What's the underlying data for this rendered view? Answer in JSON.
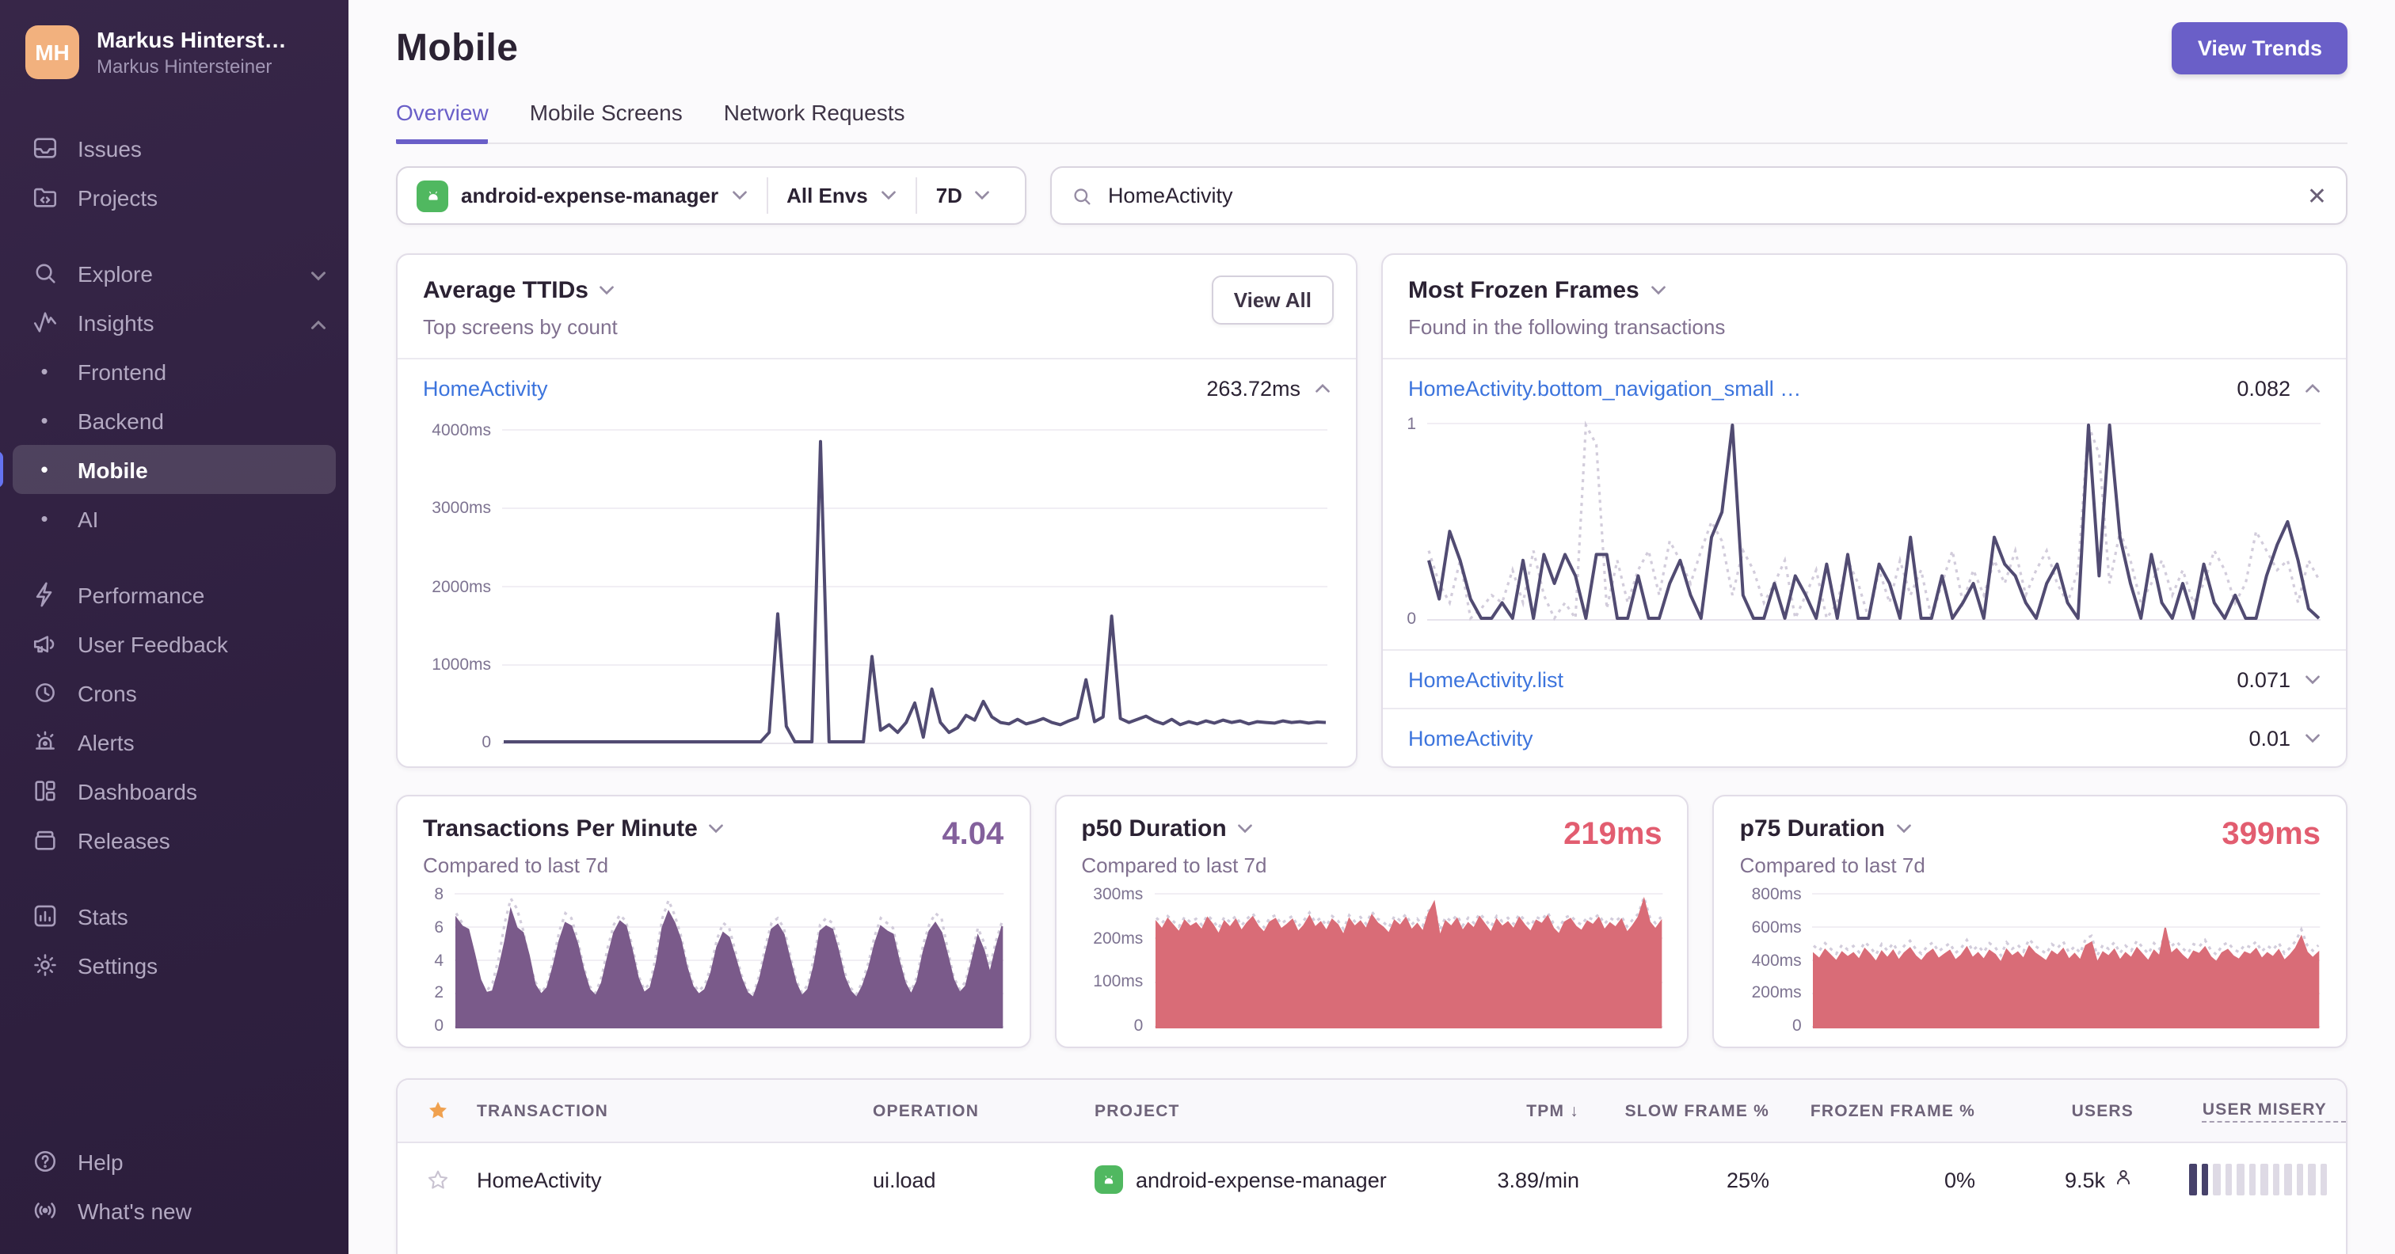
{
  "colors": {
    "accent": "#6a5fc8",
    "link": "#3c74dd",
    "star": "#f0a14f",
    "android": "#50b860",
    "purple_text": "#83609c",
    "salmon_text": "#e25d70",
    "misery_dark": "#47426b",
    "misery_light": "#dedae5",
    "sidebar_bg": "#2f2040",
    "dark_line": "#514b72",
    "compare_dotted": "#d2ccdb",
    "purple_fill": "#7a5a8a",
    "salmon_fill": "#d96c77"
  },
  "sidebar": {
    "user": {
      "initials": "MH",
      "name": "Markus Hinterst…",
      "org": "Markus Hintersteiner"
    },
    "items": [
      {
        "label": "Issues"
      },
      {
        "label": "Projects"
      },
      {
        "label": "Explore",
        "chevron": "down"
      },
      {
        "label": "Insights",
        "chevron": "up"
      },
      {
        "label": "Frontend"
      },
      {
        "label": "Backend"
      },
      {
        "label": "Mobile",
        "active": true
      },
      {
        "label": "AI"
      },
      {
        "label": "Performance"
      },
      {
        "label": "User Feedback"
      },
      {
        "label": "Crons"
      },
      {
        "label": "Alerts"
      },
      {
        "label": "Dashboards"
      },
      {
        "label": "Releases"
      },
      {
        "label": "Stats"
      },
      {
        "label": "Settings"
      },
      {
        "label": "Help"
      },
      {
        "label": "What's new"
      }
    ]
  },
  "header": {
    "title": "Mobile",
    "view_trends": "View Trends"
  },
  "tabs": [
    {
      "label": "Overview",
      "active": true
    },
    {
      "label": "Mobile Screens",
      "active": false
    },
    {
      "label": "Network Requests",
      "active": false
    }
  ],
  "filters": {
    "project": "android-expense-manager",
    "env": "All Envs",
    "period": "7D"
  },
  "search": {
    "value": "HomeActivity"
  },
  "cards": {
    "ttid": {
      "title": "Average TTIDs",
      "subtitle": "Top screens by count",
      "action": "View All",
      "row": {
        "name": "HomeActivity",
        "value": "263.72ms"
      }
    },
    "frozen": {
      "title": "Most Frozen Frames",
      "subtitle": "Found in the following transactions",
      "rows": [
        {
          "name": "HomeActivity.bottom_navigation_small …",
          "value": "0.082"
        },
        {
          "name": "HomeActivity.list",
          "value": "0.071"
        },
        {
          "name": "HomeActivity",
          "value": "0.01"
        }
      ]
    },
    "tpm": {
      "title": "Transactions Per Minute",
      "subtitle": "Compared to last 7d",
      "value": "4.04"
    },
    "p50": {
      "title": "p50 Duration",
      "subtitle": "Compared to last 7d",
      "value": "219ms"
    },
    "p75": {
      "title": "p75 Duration",
      "subtitle": "Compared to last 7d",
      "value": "399ms"
    }
  },
  "table": {
    "columns": {
      "transaction": "TRANSACTION",
      "operation": "OPERATION",
      "project": "PROJECT",
      "tpm": "TPM",
      "sort_arrow": "↓",
      "slow": "SLOW FRAME %",
      "frozen": "FROZEN FRAME %",
      "users": "USERS",
      "misery": "USER MISERY"
    },
    "rows": [
      {
        "transaction": "HomeActivity",
        "operation": "ui.load",
        "project": "android-expense-manager",
        "tpm": "3.89/min",
        "slow": "25%",
        "frozen": "0%",
        "users": "9.5k",
        "misery_filled": 2,
        "misery_total": 12
      }
    ]
  },
  "chart_data": {
    "ttid": {
      "type": "line",
      "title": "Average TTIDs - HomeActivity",
      "ylabel": "ms",
      "color": "#514b72",
      "ylim": [
        0,
        4000
      ],
      "yticks": [
        "4000ms",
        "3000ms",
        "2000ms",
        "1000ms",
        "0"
      ],
      "values": [
        0,
        0,
        0,
        0,
        0,
        0,
        0,
        0,
        0,
        0,
        0,
        0,
        0,
        0,
        0,
        0,
        0,
        0,
        0,
        0,
        0,
        0,
        0,
        0,
        0,
        0,
        0,
        0,
        0,
        0,
        0,
        120,
        1650,
        200,
        0,
        0,
        0,
        3870,
        0,
        0,
        0,
        0,
        0,
        1100,
        150,
        220,
        120,
        250,
        500,
        60,
        680,
        250,
        120,
        180,
        340,
        280,
        520,
        320,
        250,
        230,
        290,
        230,
        260,
        300,
        250,
        220,
        270,
        310,
        800,
        260,
        320,
        1620,
        300,
        250,
        290,
        330,
        270,
        230,
        290,
        220,
        260,
        230,
        270,
        240,
        280,
        250,
        270,
        230,
        260,
        250,
        240,
        270,
        250,
        260,
        240,
        255,
        250
      ]
    },
    "frozen": {
      "type": "line",
      "title": "Most Frozen Frames - HomeActivity.bottom_navigation_small",
      "color": "#514b72",
      "compare_color": "#d2ccdb",
      "ylim": [
        0,
        1
      ],
      "yticks": [
        "1",
        "0"
      ],
      "values": [
        0.3,
        0.1,
        0.45,
        0.3,
        0.1,
        0,
        0,
        0.08,
        0,
        0.3,
        0,
        0.33,
        0.18,
        0.33,
        0.22,
        0,
        0.33,
        0.33,
        0,
        0,
        0.22,
        0,
        0,
        0.18,
        0.3,
        0.12,
        0,
        0.42,
        0.55,
        1,
        0.12,
        0,
        0,
        0.18,
        0,
        0.22,
        0.12,
        0,
        0.28,
        0,
        0.33,
        0,
        0,
        0.28,
        0.18,
        0,
        0.42,
        0,
        0,
        0.22,
        0,
        0.08,
        0.18,
        0,
        0.42,
        0.28,
        0.22,
        0.08,
        0,
        0.18,
        0.28,
        0.08,
        0,
        1,
        0.22,
        1,
        0.42,
        0.18,
        0,
        0.33,
        0.08,
        0,
        0.18,
        0,
        0.28,
        0.08,
        0,
        0.12,
        0,
        0,
        0.22,
        0.38,
        0.5,
        0.3,
        0.05,
        0
      ],
      "compare": [
        0.35,
        0.18,
        0.08,
        0.3,
        0,
        0.05,
        0.12,
        0.08,
        0.25,
        0.08,
        0.35,
        0.12,
        0,
        0.08,
        0,
        1,
        0.9,
        0.05,
        0.3,
        0.08,
        0.25,
        0.35,
        0.12,
        0.4,
        0.3,
        0.18,
        0.35,
        0.5,
        0.4,
        0.12,
        0.35,
        0.25,
        0.08,
        0.18,
        0.3,
        0,
        0.12,
        0.25,
        0,
        0.08,
        0.3,
        0.18,
        0,
        0.25,
        0.08,
        0.3,
        0.12,
        0.25,
        0,
        0.18,
        0.35,
        0.08,
        0.25,
        0.12,
        0.3,
        0.18,
        0.35,
        0.12,
        0.25,
        0.35,
        0.18,
        0.08,
        0.25,
        1,
        0.85,
        0.18,
        0.45,
        0.3,
        0.08,
        0.18,
        0.3,
        0.12,
        0.25,
        0.08,
        0.18,
        0.35,
        0.25,
        0.08,
        0.18,
        0.45,
        0.35,
        0.25,
        0.3,
        0.08,
        0.3,
        0.2
      ]
    },
    "tpm": {
      "type": "area",
      "title": "Transactions Per Minute",
      "ylim": [
        0,
        8
      ],
      "color": "#7a5a8a",
      "compare_color": "#d2ccdb",
      "yticks": [
        "8",
        "6",
        "4",
        "2",
        "0"
      ],
      "values": [
        6.6,
        6.1,
        5.9,
        4.4,
        2.8,
        2.0,
        2.1,
        3.4,
        5.1,
        7.1,
        6.0,
        5.7,
        4.3,
        2.5,
        1.9,
        2.3,
        3.6,
        5.2,
        6.3,
        6.1,
        5.0,
        3.4,
        2.2,
        1.8,
        2.6,
        4.2,
        5.7,
        6.4,
        6.1,
        4.6,
        2.9,
        2.0,
        2.3,
        3.8,
        6.0,
        7.0,
        6.3,
        5.3,
        3.6,
        2.4,
        1.9,
        2.2,
        3.2,
        4.8,
        5.7,
        5.4,
        4.2,
        2.9,
        2.0,
        1.7,
        2.8,
        4.4,
        5.9,
        6.2,
        5.6,
        4.1,
        2.6,
        1.8,
        2.2,
        3.7,
        5.8,
        6.1,
        5.9,
        4.6,
        3.0,
        2.1,
        1.7,
        2.4,
        3.5,
        5.0,
        6.1,
        5.8,
        5.6,
        4.0,
        2.6,
        1.9,
        2.7,
        4.5,
        5.8,
        6.3,
        5.7,
        4.3,
        2.8,
        2.0,
        2.4,
        3.9,
        5.5,
        4.6,
        3.2,
        4.8,
        6.1
      ],
      "compare": [
        6.9,
        6.3,
        5.5,
        4.0,
        2.4,
        2.1,
        2.6,
        4.1,
        6.3,
        7.8,
        7.2,
        5.9,
        4.0,
        2.7,
        2.0,
        2.5,
        4.0,
        5.8,
        6.9,
        6.6,
        5.3,
        3.6,
        2.4,
        2.0,
        3.0,
        4.8,
        6.2,
        6.8,
        6.4,
        4.9,
        3.1,
        2.2,
        2.6,
        4.4,
        6.6,
        7.7,
        6.8,
        5.6,
        3.8,
        2.6,
        2.1,
        2.5,
        3.6,
        5.3,
        6.3,
        6.0,
        4.6,
        3.1,
        2.2,
        1.9,
        3.1,
        4.9,
        6.3,
        6.6,
        6.0,
        4.4,
        2.8,
        2.0,
        2.5,
        4.2,
        6.2,
        6.6,
        6.3,
        5.0,
        3.3,
        2.3,
        1.9,
        2.7,
        3.9,
        5.5,
        6.6,
        6.3,
        6.0,
        4.3,
        2.8,
        2.1,
        3.0,
        5.0,
        6.2,
        6.9,
        6.6,
        4.7,
        3.0,
        2.2,
        2.7,
        4.3,
        6.0,
        5.1,
        3.6,
        5.2,
        6.4
      ]
    },
    "p50": {
      "type": "area",
      "title": "p50 Duration",
      "ylim": [
        0,
        300
      ],
      "color": "#d96c77",
      "compare_color": "#d2ccdb",
      "yticks": [
        "300ms",
        "200ms",
        "100ms",
        "0"
      ],
      "values": [
        238,
        222,
        246,
        230,
        215,
        242,
        228,
        236,
        220,
        248,
        232,
        210,
        240,
        226,
        244,
        218,
        236,
        250,
        228,
        214,
        238,
        246,
        222,
        232,
        244,
        216,
        230,
        252,
        226,
        238,
        218,
        244,
        232,
        208,
        246,
        228,
        240,
        222,
        254,
        236,
        226,
        212,
        242,
        230,
        248,
        220,
        234,
        216,
        258,
        284,
        205,
        240,
        228,
        246,
        218,
        236,
        224,
        250,
        232,
        214,
        244,
        228,
        238,
        222,
        248,
        230,
        216,
        242,
        234,
        252,
        224,
        210,
        238,
        246,
        228,
        218,
        240,
        232,
        248,
        220,
        236,
        226,
        244,
        214,
        230,
        250,
        290,
        238,
        222,
        240
      ],
      "compare": [
        248,
        236,
        252,
        240,
        228,
        250,
        238,
        246,
        232,
        254,
        242,
        224,
        250,
        238,
        252,
        230,
        246,
        258,
        240,
        226,
        248,
        254,
        234,
        244,
        252,
        228,
        242,
        260,
        238,
        248,
        230,
        252,
        242,
        222,
        254,
        240,
        250,
        234,
        262,
        246,
        238,
        226,
        252,
        242,
        256,
        232,
        246,
        230,
        264,
        272,
        220,
        250,
        240,
        254,
        230,
        248,
        236,
        258,
        244,
        228,
        252,
        240,
        248,
        234,
        256,
        242,
        230,
        250,
        244,
        260,
        236,
        224,
        248,
        254,
        240,
        232,
        250,
        244,
        256,
        234,
        248,
        240,
        252,
        228,
        244,
        258,
        296,
        250,
        236,
        250
      ]
    },
    "p75": {
      "type": "area",
      "title": "p75 Duration",
      "ylim": [
        0,
        800
      ],
      "color": "#d96c77",
      "compare_color": "#d2ccdb",
      "yticks": [
        "800ms",
        "600ms",
        "400ms",
        "200ms",
        "0"
      ],
      "values": [
        440,
        410,
        465,
        430,
        395,
        450,
        420,
        445,
        405,
        470,
        435,
        390,
        455,
        415,
        460,
        400,
        445,
        475,
        425,
        395,
        440,
        465,
        410,
        435,
        460,
        400,
        430,
        480,
        415,
        445,
        405,
        460,
        435,
        385,
        465,
        425,
        450,
        410,
        485,
        445,
        420,
        395,
        455,
        430,
        470,
        405,
        440,
        400,
        490,
        510,
        385,
        450,
        425,
        465,
        400,
        445,
        415,
        475,
        435,
        395,
        460,
        425,
        600,
        440,
        470,
        430,
        400,
        455,
        440,
        480,
        420,
        390,
        445,
        465,
        425,
        405,
        450,
        435,
        470,
        410,
        445,
        420,
        462,
        398,
        432,
        475,
        545,
        450,
        415,
        448
      ],
      "compare": [
        490,
        460,
        505,
        470,
        440,
        495,
        465,
        488,
        450,
        512,
        480,
        435,
        500,
        460,
        505,
        445,
        490,
        520,
        470,
        440,
        485,
        510,
        455,
        480,
        505,
        445,
        475,
        525,
        460,
        490,
        450,
        505,
        480,
        430,
        510,
        470,
        495,
        455,
        530,
        490,
        465,
        440,
        500,
        475,
        515,
        450,
        485,
        445,
        535,
        550,
        430,
        495,
        470,
        510,
        445,
        490,
        460,
        520,
        480,
        440,
        505,
        470,
        560,
        485,
        515,
        475,
        445,
        500,
        485,
        525,
        465,
        435,
        490,
        510,
        470,
        450,
        495,
        480,
        515,
        455,
        490,
        465,
        507,
        443,
        477,
        520,
        590,
        495,
        460,
        493
      ]
    }
  }
}
